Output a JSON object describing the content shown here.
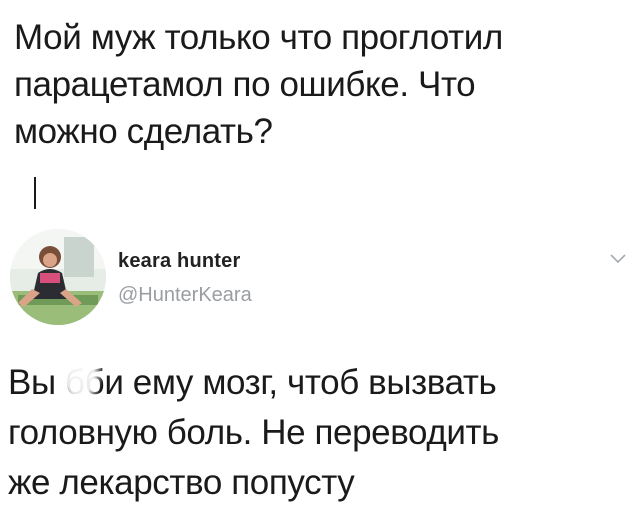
{
  "question": {
    "text": "Мой муж только что проглотил\nпарацетамол по ошибке. Что\nможно сделать?"
  },
  "tweet": {
    "display_name": "keara hunter",
    "handle": "@HunterKeara",
    "avatar_icon": "profile-photo-avatar",
    "menu_icon": "chevron-down-icon",
    "text": "Вы бби ему мозг, чтоб вызвать\nголовную боль. Не переводить\nже лекарство попусту"
  },
  "colors": {
    "text": "#1a1a1a",
    "handle": "#9a9ea3",
    "background": "#ffffff"
  }
}
